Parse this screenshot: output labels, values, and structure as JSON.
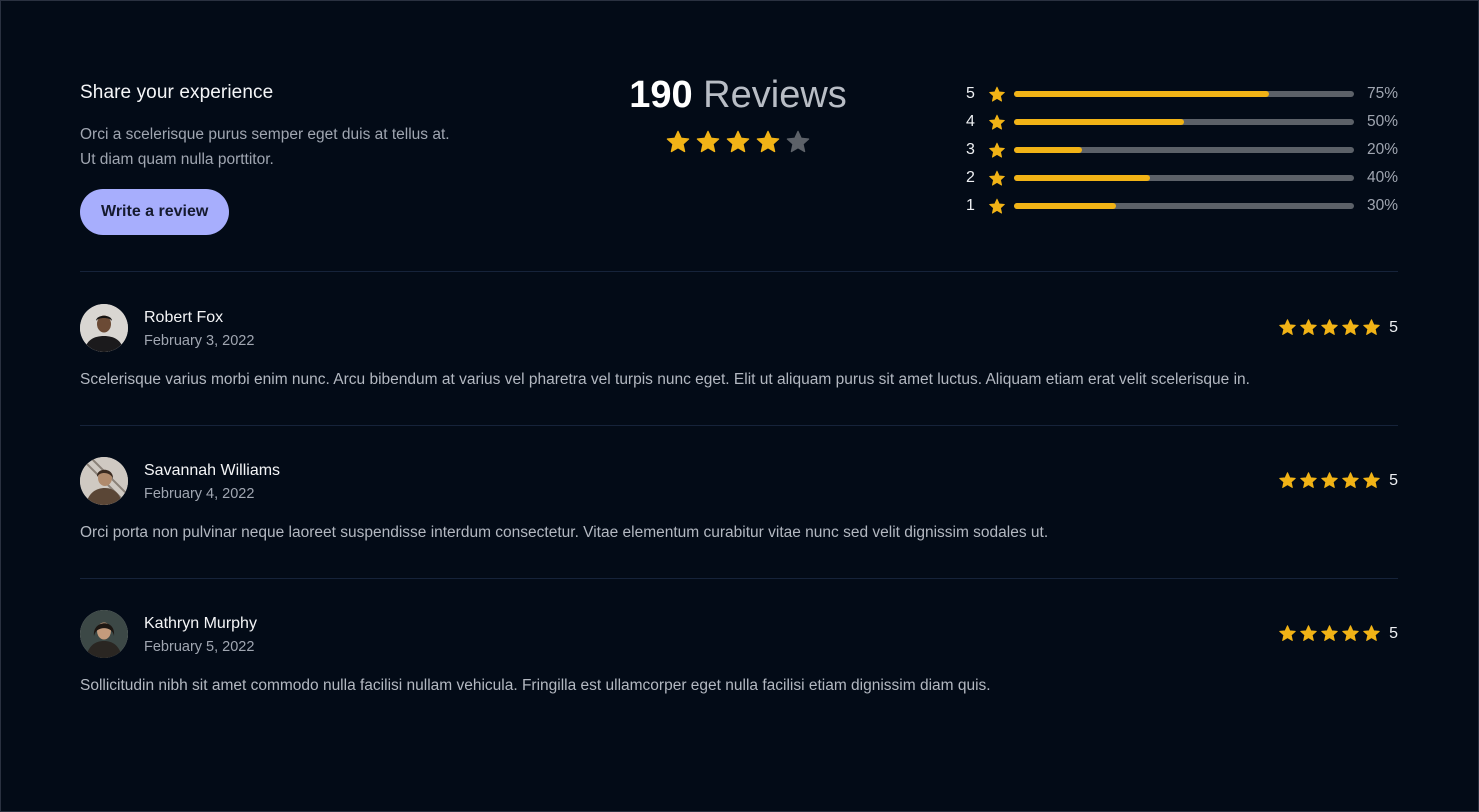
{
  "share": {
    "title": "Share your experience",
    "description_lines": [
      "Orci a scelerisque purus semper eget duis at tellus at.",
      "Ut diam quam nulla porttitor."
    ],
    "button_label": "Write a review"
  },
  "summary": {
    "count": "190",
    "label": "Reviews",
    "average_stars_filled": 4,
    "stars_total": 5
  },
  "distribution": [
    {
      "stars": "5",
      "fraction": 0.75,
      "percent_label": "75%"
    },
    {
      "stars": "4",
      "fraction": 0.5,
      "percent_label": "50%"
    },
    {
      "stars": "3",
      "fraction": 0.2,
      "percent_label": "20%"
    },
    {
      "stars": "2",
      "fraction": 0.4,
      "percent_label": "40%"
    },
    {
      "stars": "1",
      "fraction": 0.3,
      "percent_label": "30%"
    }
  ],
  "reviews": [
    {
      "name": "Robert Fox",
      "date": "February 3, 2022",
      "rating": "5",
      "text": "Scelerisque varius morbi enim nunc. Arcu bibendum at varius vel pharetra vel turpis nunc eget. Elit ut aliquam purus sit amet luctus. Aliquam etiam erat velit scelerisque in."
    },
    {
      "name": "Savannah Williams",
      "date": "February 4, 2022",
      "rating": "5",
      "text": "Orci porta non pulvinar neque laoreet suspendisse interdum consectetur. Vitae elementum curabitur vitae nunc sed velit dignissim sodales ut."
    },
    {
      "name": "Kathryn Murphy",
      "date": "February 5, 2022",
      "rating": "5",
      "text": "Sollicitudin nibh sit amet commodo nulla facilisi nullam vehicula. Fringilla est ullamcorper eget nulla facilisi etiam dignissim diam quis."
    }
  ],
  "colors": {
    "background": "#030b17",
    "star_filled": "#f1b316",
    "star_empty": "#5c6168",
    "button": "#a7aefd",
    "bar_track": "#5c6168"
  },
  "icons": {
    "star": "star-icon"
  }
}
